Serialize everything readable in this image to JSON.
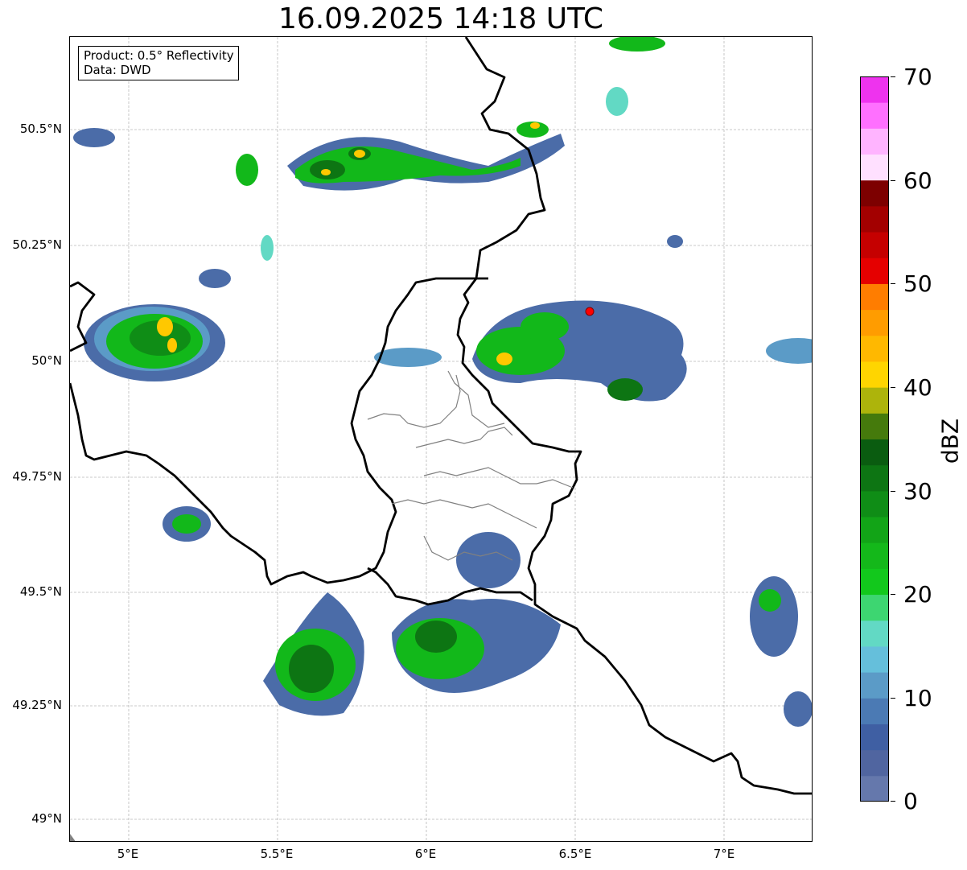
{
  "title": "16.09.2025 14:18 UTC",
  "info_box": {
    "product": "Product: 0.5° Reflectivity",
    "data": "Data: DWD"
  },
  "lat_labels": [
    "50.5°N",
    "50.25°N",
    "50°N",
    "49.75°N",
    "49.5°N",
    "49.25°N",
    "49°N"
  ],
  "lon_labels": [
    "5°E",
    "5.5°E",
    "6°E",
    "6.5°E",
    "7°E"
  ],
  "colorbar": {
    "label": "dBZ",
    "tick_labels": [
      "0",
      "10",
      "20",
      "30",
      "40",
      "50",
      "60",
      "70"
    ],
    "range": [
      0,
      70
    ],
    "step": 2.5,
    "colors": [
      "#6578ac",
      "#5065a0",
      "#3f5fa3",
      "#4b7ab4",
      "#5b9bc7",
      "#65bfdb",
      "#62d9c4",
      "#3dd671",
      "#12c81c",
      "#14b81a",
      "#12a417",
      "#0f8d16",
      "#0d7513",
      "#0a5c10",
      "#457a0c",
      "#adb40b",
      "#ffd500",
      "#ffb800",
      "#ff9c00",
      "#ff7d00",
      "#e50000",
      "#c50000",
      "#a30000",
      "#7d0000",
      "#ffe0ff",
      "#ffb4ff",
      "#ff70ff",
      "#ee33ee"
    ]
  },
  "map": {
    "lon_range": [
      4.8,
      7.3
    ],
    "lat_range": [
      48.95,
      50.7
    ],
    "grid": true,
    "radar_site_color": "#ff0000"
  }
}
